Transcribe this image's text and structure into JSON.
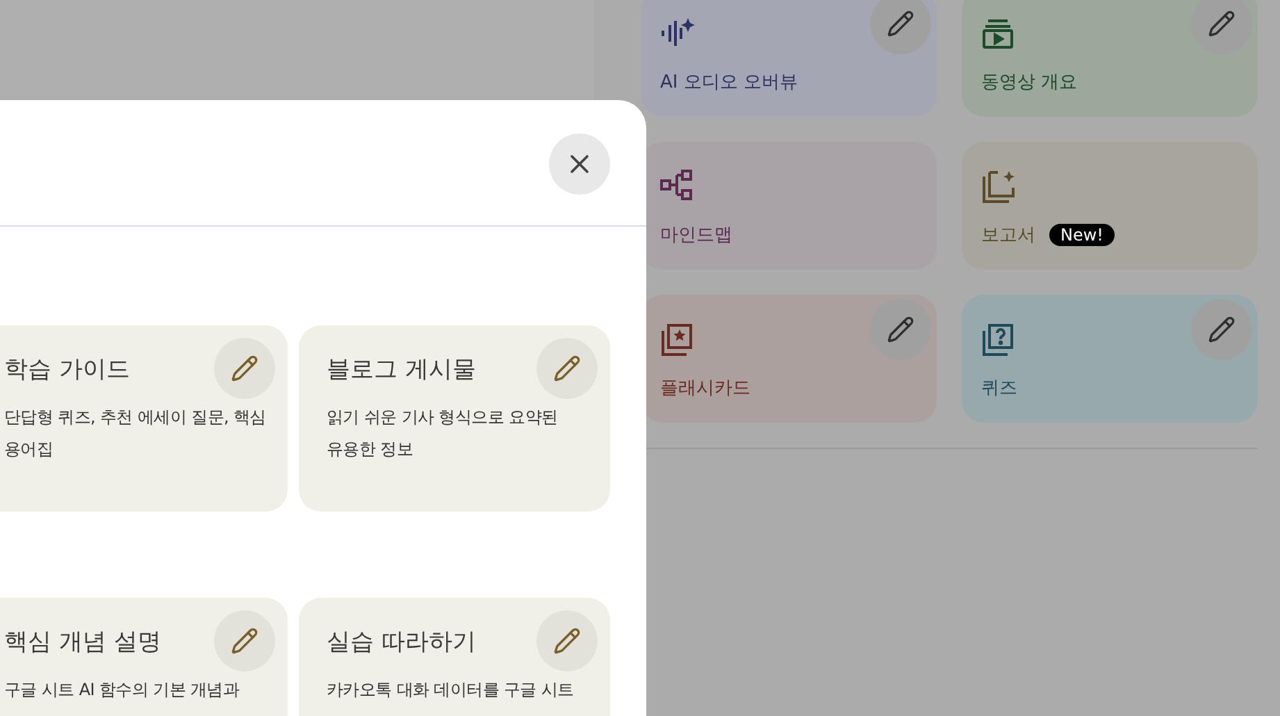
{
  "studio_tiles": [
    {
      "kind": "audio",
      "label": "AI 오디오 오버뷰",
      "color": "#a5a6b3",
      "editable": true
    },
    {
      "kind": "video",
      "label": "동영상 개요",
      "color": "#9ba89b",
      "editable": true
    },
    {
      "kind": "mindmap",
      "label": "마인드맵",
      "color": "#a9a3a8",
      "editable": false
    },
    {
      "kind": "report",
      "label": "보고서",
      "badge": "New!",
      "color": "#a8a69c",
      "editable": false
    },
    {
      "kind": "flashcards",
      "label": "플래시카드",
      "color": "#aca09f",
      "editable": true
    },
    {
      "kind": "quiz",
      "label": "퀴즈",
      "color": "#98a9ae",
      "editable": true
    }
  ],
  "dialog": {
    "cards": [
      {
        "title": "학습 가이드",
        "description": "단답형 퀴즈, 추천 에세이 질문, 핵심 용어집"
      },
      {
        "title": "블로그 게시물",
        "description": "읽기 쉬운 기사 형식으로 요약된 유용한 정보"
      },
      {
        "title": "핵심 개념 설명",
        "description": "구글 시트 AI 함수의 기본 개념과"
      },
      {
        "title": "실습 따라하기",
        "description": "카카오톡 대화 데이터를 구글 시트"
      }
    ]
  }
}
